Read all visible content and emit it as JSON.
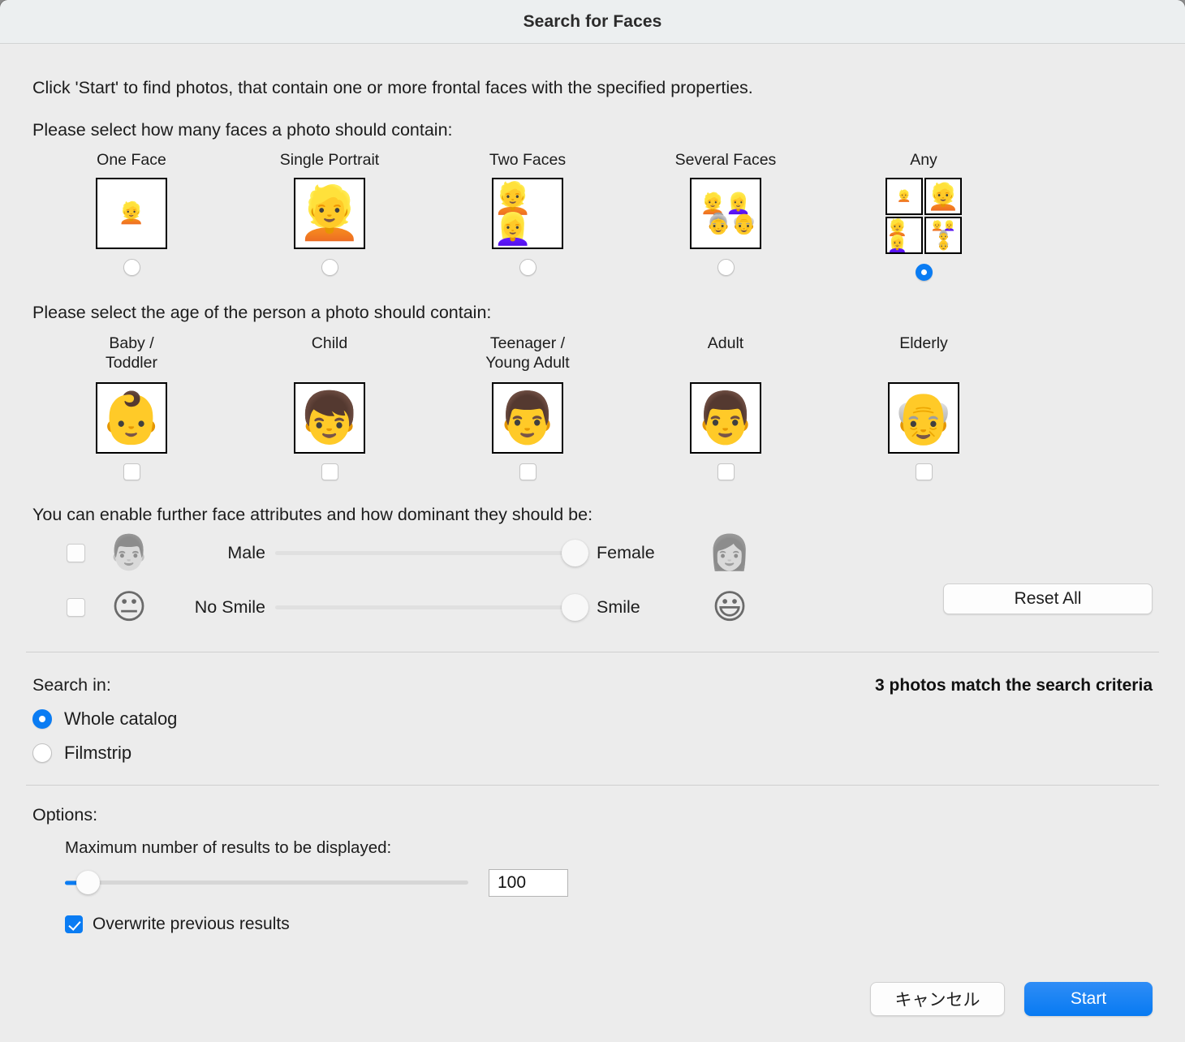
{
  "window": {
    "title": "Search for Faces"
  },
  "intro": "Click 'Start' to find photos, that contain one or more frontal faces with the specified properties.",
  "face_count": {
    "prompt": "Please select how many faces a photo should contain:",
    "options": [
      {
        "label": "One Face",
        "selected": false,
        "emoji": "👱",
        "kind": "single-small"
      },
      {
        "label": "Single Portrait",
        "selected": false,
        "emoji": "👱",
        "kind": "single-large"
      },
      {
        "label": "Two Faces",
        "selected": false,
        "emoji": "👱👱‍♀️",
        "kind": "two"
      },
      {
        "label": "Several Faces",
        "selected": false,
        "emoji": "👱👱‍♀️👵👴",
        "kind": "several"
      },
      {
        "label": "Any",
        "selected": true,
        "kind": "grid"
      }
    ]
  },
  "age": {
    "prompt": "Please select the age of the person a photo should contain:",
    "options": [
      {
        "label": "Baby / Toddler",
        "label_line1": "Baby /",
        "label_line2": "Toddler",
        "checked": false,
        "emoji": "👶"
      },
      {
        "label": "Child",
        "label_line1": "Child",
        "label_line2": "",
        "checked": false,
        "emoji": "👦"
      },
      {
        "label": "Teenager / Young Adult",
        "label_line1": "Teenager /",
        "label_line2": "Young Adult",
        "checked": false,
        "emoji": "👨"
      },
      {
        "label": "Adult",
        "label_line1": "Adult",
        "label_line2": "",
        "checked": false,
        "emoji": "👨"
      },
      {
        "label": "Elderly",
        "label_line1": "Elderly",
        "label_line2": "",
        "checked": false,
        "emoji": "👴"
      }
    ]
  },
  "attributes": {
    "heading": "You can enable further face attributes and how dominant they should be:",
    "rows": [
      {
        "enabled": false,
        "left_label": "Male",
        "right_label": "Female",
        "left_emoji": "👨",
        "right_emoji": "👩",
        "value": 100,
        "disabled": true
      },
      {
        "enabled": false,
        "left_label": "No Smile",
        "right_label": "Smile",
        "left_emoji": "😐",
        "right_emoji": "😃",
        "value": 100,
        "disabled": true
      }
    ],
    "reset_label": "Reset All"
  },
  "search_in": {
    "label": "Search in:",
    "match_text": "3 photos match the search criteria",
    "options": [
      {
        "label": "Whole catalog",
        "selected": true
      },
      {
        "label": "Filmstrip",
        "selected": false
      }
    ]
  },
  "options": {
    "title": "Options:",
    "max_results_label": "Maximum number of results to be displayed:",
    "max_results_value": "100",
    "slider_percent": 4,
    "overwrite_label": "Overwrite previous results",
    "overwrite_checked": true
  },
  "footer": {
    "cancel_label": "キャンセル",
    "start_label": "Start"
  },
  "colors": {
    "accent": "#0a7cf3",
    "window_bg": "#ececec",
    "titlebar_bg": "#eceff0"
  }
}
